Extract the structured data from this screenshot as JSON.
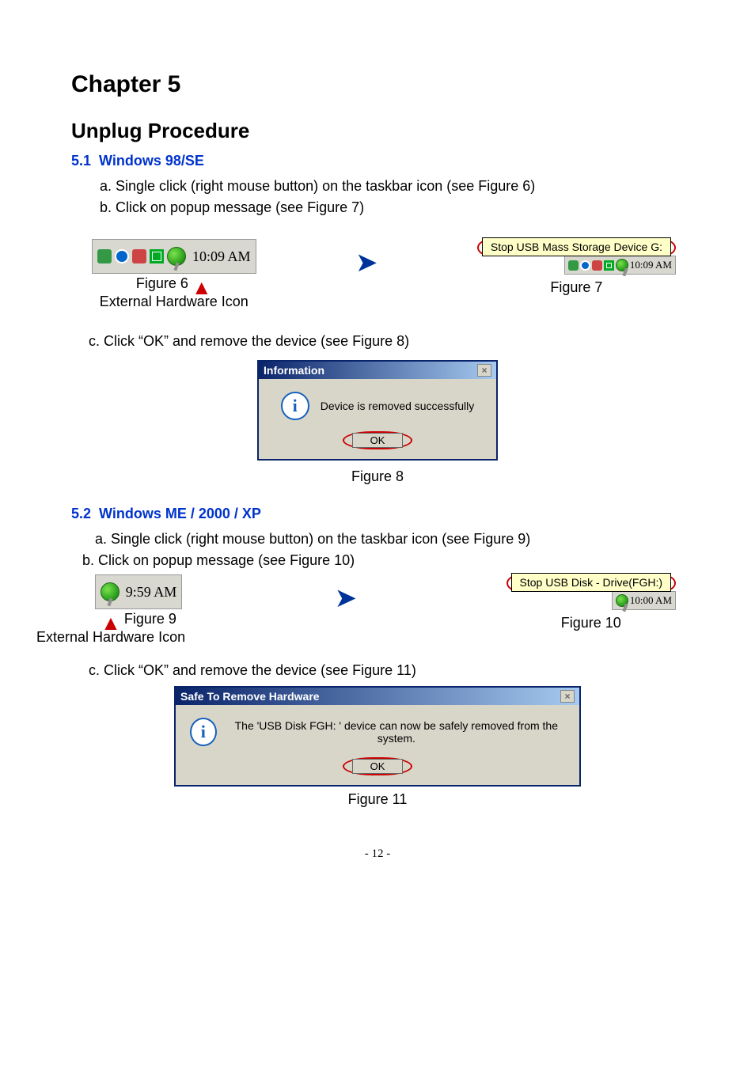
{
  "chapter": "Chapter 5",
  "section": "Unplug Procedure",
  "s51": {
    "heading_num": "5.1",
    "heading_text": "Windows 98/SE",
    "step_a": "a. Single click (right mouse button) on the taskbar icon  (see Figure 6)",
    "step_b": "b. Click on popup message (see Figure 7)",
    "step_c": "c. Click “OK” and remove the device (see Figure 8)",
    "fig6_caption_a": "Figure 6",
    "fig6_caption_arrow": "▲",
    "fig6_caption_b": "External Hardware Icon",
    "fig7_caption": "Figure 7",
    "tray_time": "10:09 AM",
    "popup_text": "Stop USB Mass Storage Device G:",
    "popup_tray_time": "10:09 AM",
    "dialog_title": "Information",
    "dialog_msg": "Device is removed successfully",
    "ok": "OK",
    "fig8_caption": "Figure 8"
  },
  "s52": {
    "heading_num": "5.2",
    "heading_text": "Windows ME / 2000 / XP",
    "step_a": "a. Single click (right mouse button) on the taskbar icon (see Figure 9)",
    "step_b": "b. Click on popup message (see Figure 10)",
    "step_c": "c. Click “OK” and remove the device (see Figure 11)",
    "fig9_caption_a": "Figure 9",
    "fig9_caption_arrow": "▲",
    "fig9_caption_b": "External Hardware Icon",
    "fig10_caption": "Figure 10",
    "tray_time": "9:59 AM",
    "popup_text": "Stop USB Disk - Drive(FGH:)",
    "popup_tray_time": "10:00 AM",
    "dialog_title": "Safe To Remove Hardware",
    "dialog_msg": "The 'USB Disk FGH: ' device can now be safely removed from the system.",
    "ok": "OK",
    "fig11_caption": "Figure 11"
  },
  "arrow_right": "➤",
  "close_x": "×",
  "page_number": "- 12 -"
}
